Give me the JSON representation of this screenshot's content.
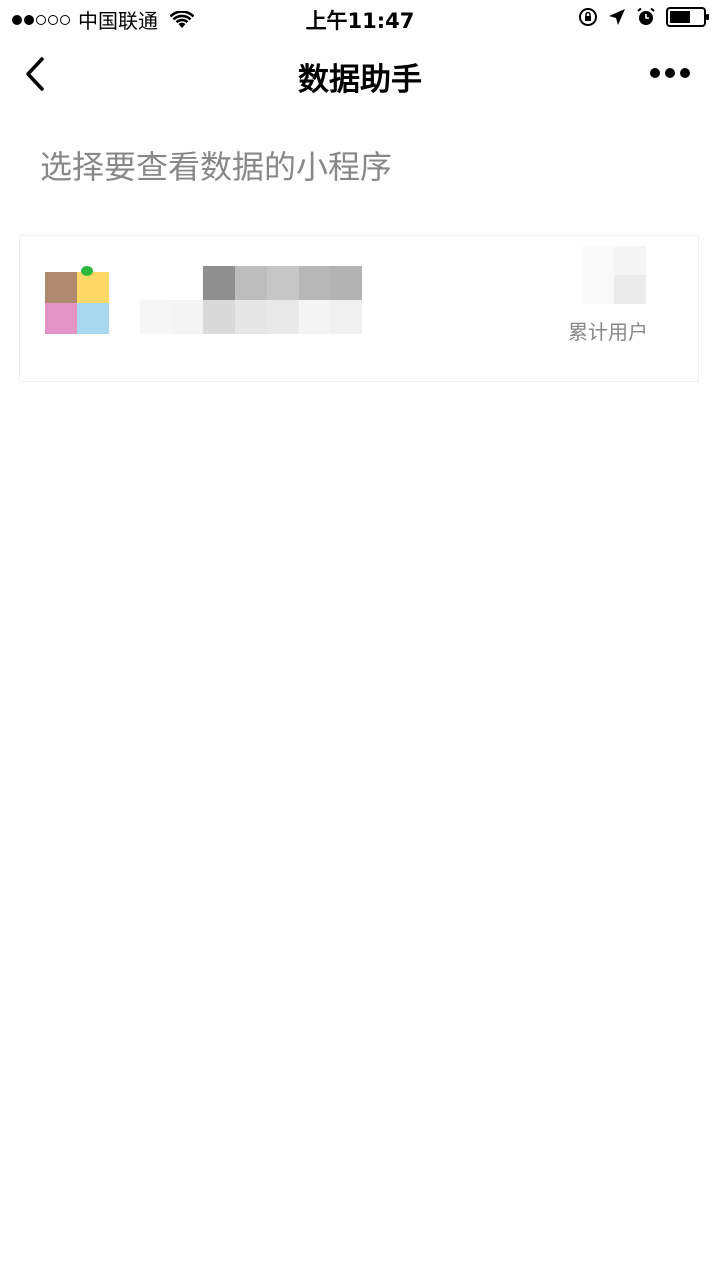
{
  "status_bar": {
    "carrier": "中国联通",
    "time": "上午11:47",
    "signal_filled": 2,
    "signal_total": 5,
    "icons": [
      "wifi-icon",
      "orientation-lock-icon",
      "location-arrow-icon",
      "alarm-icon",
      "battery-icon"
    ]
  },
  "nav": {
    "title": "数据助手",
    "back_icon": "chevron-left-icon",
    "more_icon": "more-dots-icon"
  },
  "subtitle": "选择要查看数据的小程序",
  "mini_program": {
    "stat_label": "累计用户"
  }
}
